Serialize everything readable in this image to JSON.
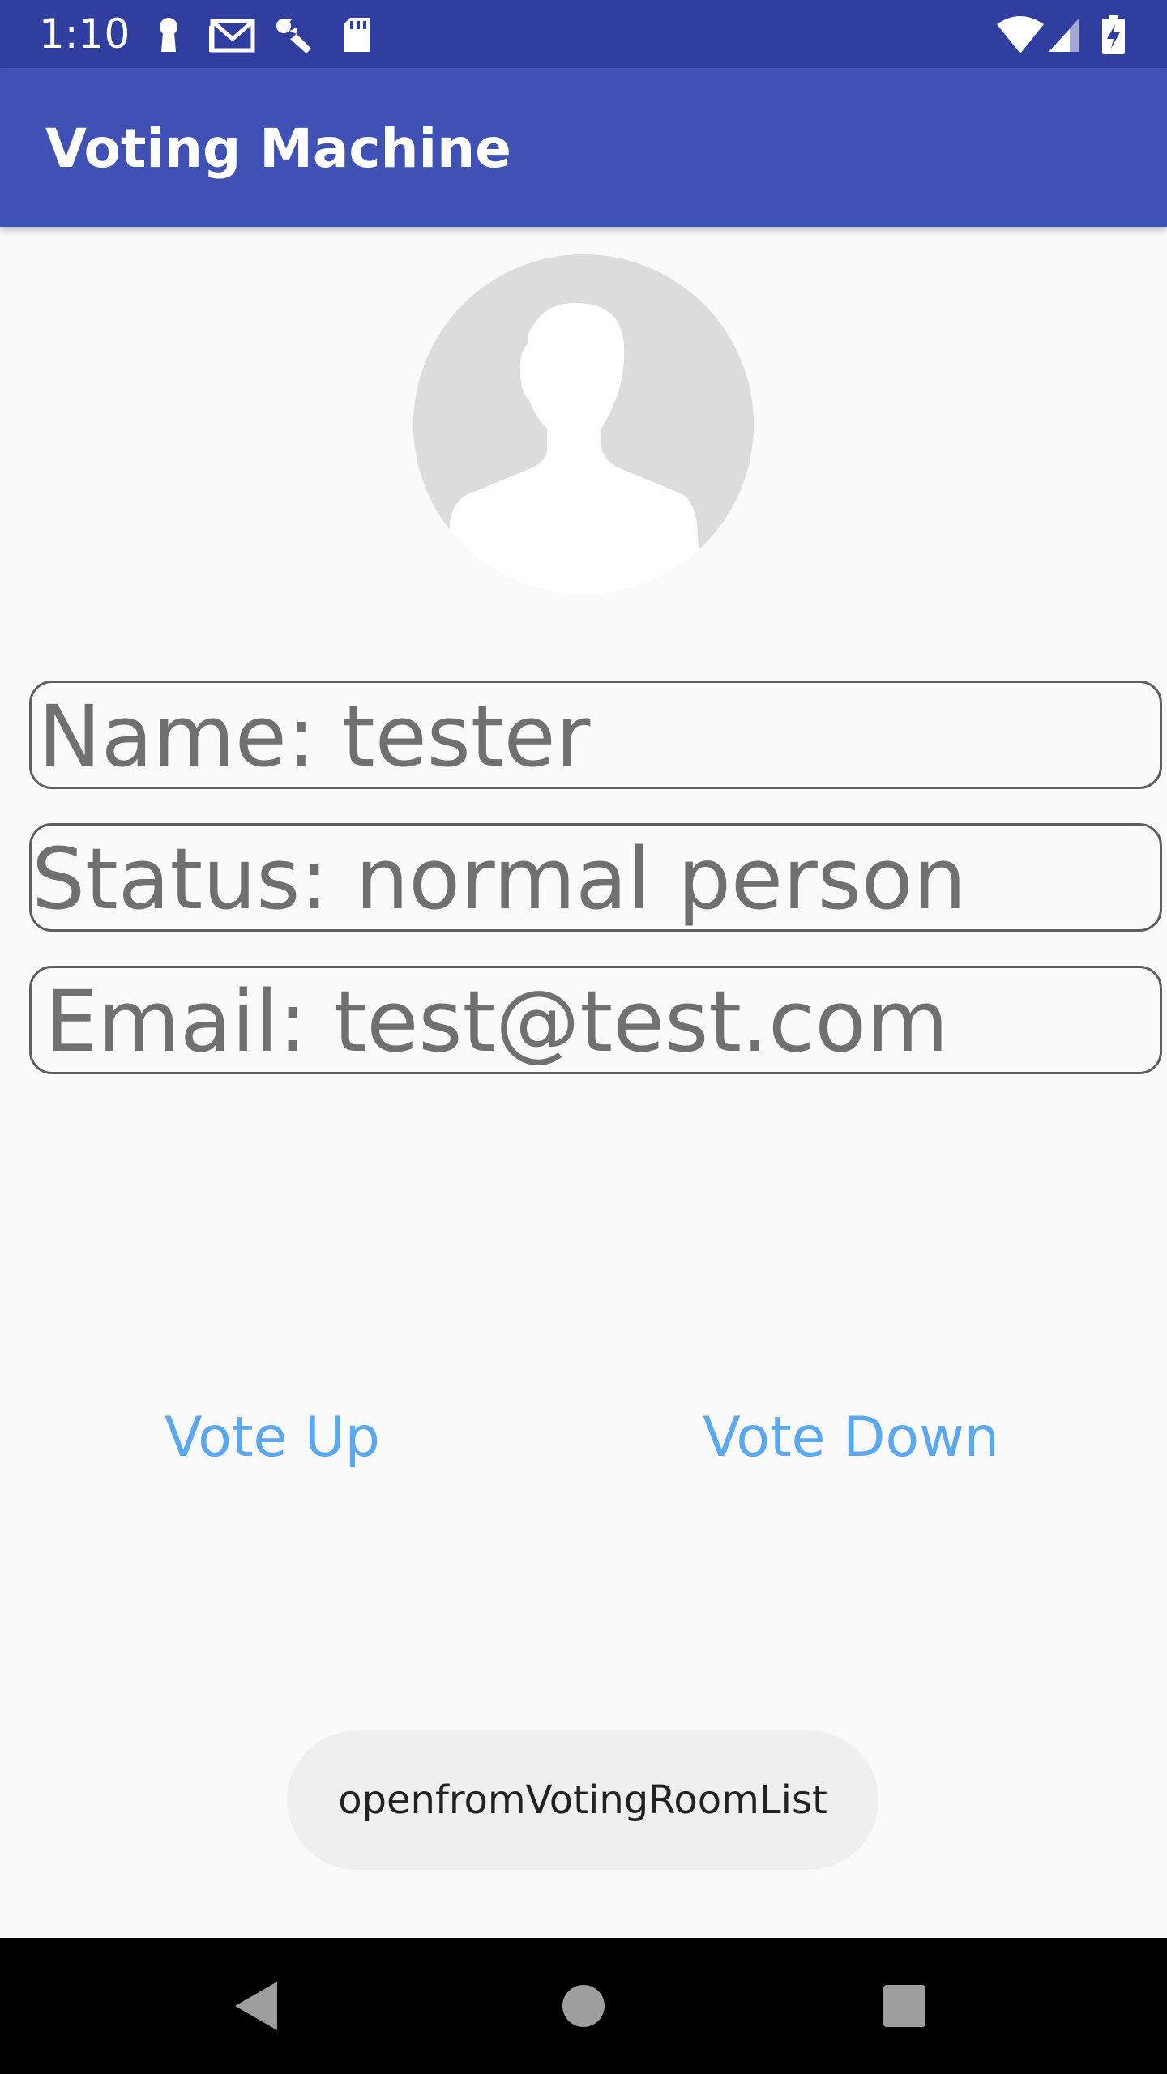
{
  "status_bar": {
    "time": "1:10",
    "icons": [
      "keyhole-icon",
      "gmail-icon",
      "wrench-icon",
      "sd-card-icon",
      "wifi-icon",
      "signal-icon",
      "battery-charging-icon"
    ]
  },
  "app_bar": {
    "title": "Voting Machine"
  },
  "profile": {
    "avatar_icon": "person-silhouette-icon",
    "name": "Name:  tester",
    "status": "Status: normal person",
    "email": "Email:  test@test.com"
  },
  "actions": {
    "vote_up": "Vote Up",
    "vote_down": "Vote Down"
  },
  "toast": {
    "message": "openfromVotingRoomList"
  },
  "nav_bar": {
    "back": "back-icon",
    "home": "home-icon",
    "recents": "recents-icon"
  },
  "colors": {
    "status_bar": "#303f9f",
    "app_bar": "#3f51b5",
    "background": "#fafafa",
    "field_text": "#707070",
    "vote_text": "#5aa8f0",
    "toast_bg": "#efefef"
  }
}
